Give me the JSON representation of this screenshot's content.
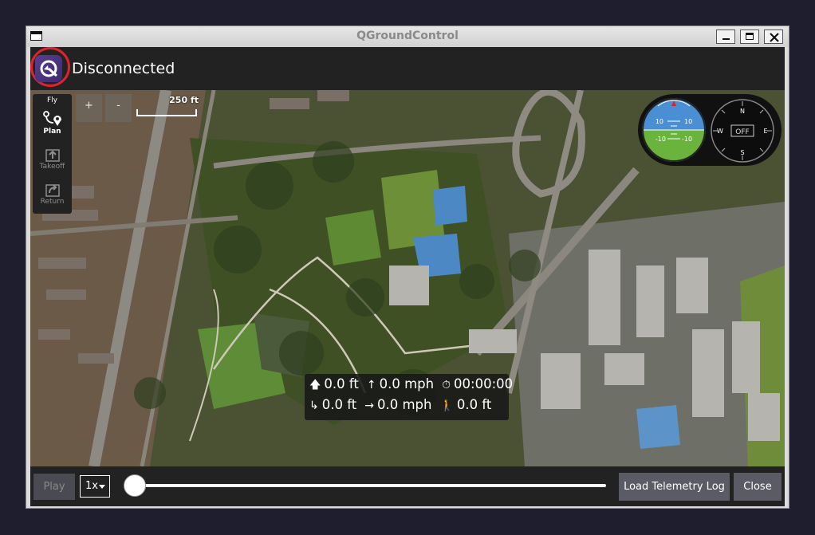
{
  "window": {
    "title": "QGroundControl"
  },
  "toolbar": {
    "status": "Disconnected",
    "logo_icon": "qgc-logo-icon"
  },
  "plan_tools": {
    "fly_label": "Fly",
    "plan_label": "Plan",
    "takeoff_label": "Takeoff",
    "return_label": "Return"
  },
  "map": {
    "zoom_in_label": "+",
    "zoom_out_label": "-",
    "scale_label": "250 ft"
  },
  "instruments": {
    "pitch_marks": [
      "10",
      "10",
      "-10",
      "-10"
    ],
    "compass_n": "N",
    "compass_e": "E",
    "compass_s": "S",
    "compass_w": "W",
    "compass_state": "OFF"
  },
  "telemetry": {
    "altitude": "0.0 ft",
    "vertical_speed": "0.0 mph",
    "flight_time": "00:00:00",
    "distance": "0.0 ft",
    "ground_speed": "0.0 mph",
    "distance_to_home": "0.0 ft"
  },
  "playback": {
    "play_label": "Play",
    "rate_label": "1x",
    "progress": 0,
    "load_label": "Load Telemetry Log",
    "close_label": "Close"
  },
  "colors": {
    "background": "#1f1e2e",
    "panel": "#222222",
    "button": "#5b5b66",
    "sky": "#4a8fd4",
    "ground": "#6ab33c",
    "highlight_ring": "#e0222c"
  }
}
